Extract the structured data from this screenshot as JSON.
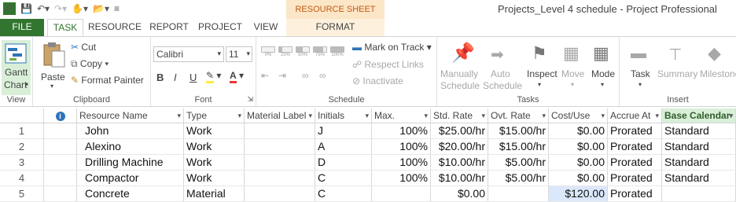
{
  "app": {
    "window_title": "Projects_Level 4 schedule - Project Professional",
    "tools_header": "RESOURCE SHEET TOOLS"
  },
  "tabs": {
    "file": "FILE",
    "task": "TASK",
    "resource": "RESOURCE",
    "report": "REPORT",
    "project": "PROJECT",
    "view": "VIEW",
    "format": "FORMAT"
  },
  "ribbon": {
    "view": {
      "gantt_line1": "Gantt",
      "gantt_line2": "Chart",
      "label": "View"
    },
    "clipboard": {
      "paste": "Paste",
      "cut": "Cut",
      "copy": "Copy",
      "format_painter": "Format Painter",
      "label": "Clipboard"
    },
    "font": {
      "family": "Calibri",
      "size": "11",
      "bold": "B",
      "italic": "I",
      "underline": "U",
      "label": "Font"
    },
    "schedule": {
      "pct": [
        "0%",
        "25%",
        "50%",
        "75%",
        "100%"
      ],
      "mark_on_track": "Mark on Track",
      "respect_links": "Respect Links",
      "inactivate": "Inactivate",
      "label": "Schedule"
    },
    "tasks": {
      "manually_1": "Manually",
      "manually_2": "Schedule",
      "auto_1": "Auto",
      "auto_2": "Schedule",
      "inspect": "Inspect",
      "move": "Move",
      "mode": "Mode",
      "label": "Tasks"
    },
    "insert": {
      "task": "Task",
      "summary": "Summary",
      "milestone": "Milestone",
      "label": "Insert"
    }
  },
  "grid": {
    "headers": [
      "",
      "ℹ",
      "Resource Name",
      "Type",
      "Material Label",
      "Initials",
      "Max.",
      "Std. Rate",
      "Ovt. Rate",
      "Cost/Use",
      "Accrue At",
      "Base Calendar"
    ],
    "rows": [
      {
        "id": "1",
        "name": "John",
        "type": "Work",
        "material": "",
        "initials": "J",
        "max": "100%",
        "std": "$25.00/hr",
        "ovt": "$15.00/hr",
        "cost": "$0.00",
        "accrue": "Prorated",
        "calendar": "Standard"
      },
      {
        "id": "2",
        "name": "Alexino",
        "type": "Work",
        "material": "",
        "initials": "A",
        "max": "100%",
        "std": "$20.00/hr",
        "ovt": "$15.00/hr",
        "cost": "$0.00",
        "accrue": "Prorated",
        "calendar": "Standard"
      },
      {
        "id": "3",
        "name": "Drilling Machine",
        "type": "Work",
        "material": "",
        "initials": "D",
        "max": "100%",
        "std": "$10.00/hr",
        "ovt": "$5.00/hr",
        "cost": "$0.00",
        "accrue": "Prorated",
        "calendar": "Standard"
      },
      {
        "id": "4",
        "name": "Compactor",
        "type": "Work",
        "material": "",
        "initials": "C",
        "max": "100%",
        "std": "$10.00/hr",
        "ovt": "$5.00/hr",
        "cost": "$0.00",
        "accrue": "Prorated",
        "calendar": "Standard"
      },
      {
        "id": "5",
        "name": "Concrete",
        "type": "Material",
        "material": "",
        "initials": "C",
        "max": "",
        "std": "$0.00",
        "ovt": "",
        "cost": "$120.00",
        "accrue": "Prorated",
        "calendar": ""
      }
    ]
  }
}
